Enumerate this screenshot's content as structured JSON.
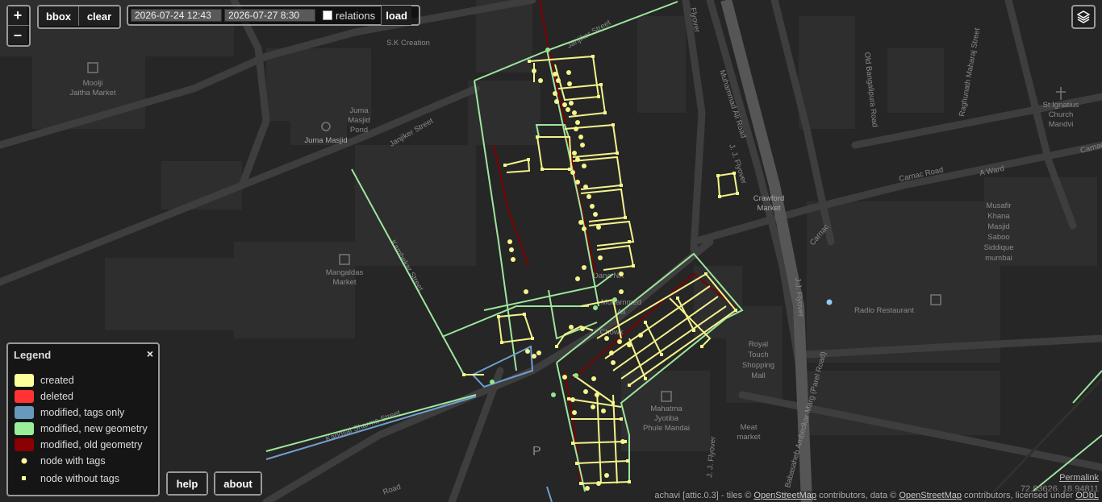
{
  "controls": {
    "zoom_in": "+",
    "zoom_out": "–",
    "bbox": "bbox",
    "clear": "clear",
    "date_from": "2026-07-24 12:43",
    "date_to": "2026-07-27 8:30",
    "relations_label": "relations",
    "relations_checked": false,
    "load": "load",
    "help": "help",
    "about": "about",
    "layers_icon": "layers-icon"
  },
  "legend": {
    "title": "Legend",
    "close": "×",
    "items": [
      {
        "label": "created",
        "color": "#ffff99",
        "kind": "swatch"
      },
      {
        "label": "deleted",
        "color": "#ff3333",
        "kind": "swatch"
      },
      {
        "label": "modified, tags only",
        "color": "#6699bb",
        "kind": "swatch"
      },
      {
        "label": "modified, new geometry",
        "color": "#99ee99",
        "kind": "swatch"
      },
      {
        "label": "modified, old geometry",
        "color": "#8b0000",
        "kind": "swatch"
      },
      {
        "label": "node with tags",
        "color": "#ffff99",
        "kind": "dot"
      },
      {
        "label": "node without tags",
        "color": "#ffff99",
        "kind": "square"
      }
    ]
  },
  "attribution": {
    "prefix": "achavi [attic.0.3]  -  tiles ©",
    "osm1": "OpenStreetMap",
    "mid": "contributors, data ©",
    "osm2": "OpenStreetMap",
    "suffix": "contributors, licensed under",
    "odbl": "ODbL"
  },
  "permalink": "Permalink",
  "coordinates": "72.83626, 18.94811",
  "map_labels": {
    "sk_creation": "S.K Creation",
    "moolji": "Moolji",
    "jaitha_market": "Jaitha Market",
    "juma_masjid_pond_1": "Juma",
    "juma_masjid_pond_2": "Masjid",
    "juma_masjid_pond_3": "Pond",
    "juma_masjid": "Juma Masjid",
    "janjiker_1": "Janjiker Street",
    "janjiker_2": "Janjiker Street",
    "mangaldas_1": "Mangaldas",
    "mangaldas_2": "Market",
    "muhammad_ali": "Muhammad Ali Road",
    "flyover_top": "Flyover",
    "jj_flyover_1": "J. J. Flyover",
    "jj_flyover_2": "J.J. Flyover",
    "jj_flyover_3": "J. J. Flyover",
    "old_bangalipura": "Old Bangalipura Road",
    "raghunath": "Raghunath Maharaj Street",
    "st_ignatius_1": "St Ignatius",
    "st_ignatius_2": "Church",
    "st_ignatius_3": "Mandvi",
    "carnac_road_1": "Carnac Road",
    "carnac_road_2": "Carnac",
    "carnac_road_3": "Carnac Road",
    "a_ward": "A Ward",
    "crawford_1": "Crawford",
    "crawford_2": "Market",
    "musafir_1": "Musafir",
    "musafir_2": "Khana",
    "musafir_3": "Masjid",
    "musafir_4": "Saboo",
    "musafir_5": "Siddique",
    "musafir_6": "mumbai",
    "radio_restaurant": "Radio Restaurant",
    "royal_1": "Royal",
    "royal_2": "Touch",
    "royal_3": "Shopping",
    "royal_4": "Mall",
    "mahatma_1": "Mahatma",
    "mahatma_2": "Jyotiba",
    "mahatma_3": "Phule Mandai",
    "meat_1": "Meat",
    "meat_2": "market",
    "ambedkar": "Dr. Babasaheb Ambedkar Marg (Parel Road)",
    "kambekar": "Kambekar Street",
    "kandilal": "Kandilal Sharma Street",
    "road_bottom": "Road",
    "dana_nx": "Dana NX",
    "chowk_1": "Mohammed",
    "chowk_2": "Ali",
    "chowk_3": "Chowk",
    "p_parking": "P"
  }
}
